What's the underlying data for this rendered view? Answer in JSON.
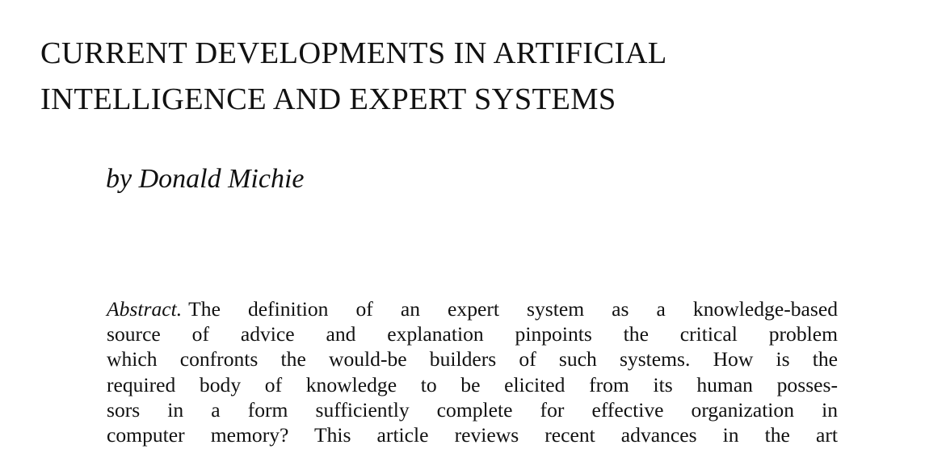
{
  "article": {
    "title_lines": [
      "CURRENT DEVELOPMENTS IN ARTIFICIAL",
      "INTELLIGENCE AND EXPERT SYSTEMS"
    ],
    "byline": "by Donald Michie",
    "abstract_label": "Abstract.",
    "abstract_lines": [
      "The definition of an expert system as a knowledge-based",
      "source of advice and explanation pinpoints the critical problem",
      "which confronts the would-be builders of such systems. How is the",
      "required body of knowledge to be elicited from its human posses-",
      "sors in a form sufficiently complete for effective organization in",
      "computer memory? This article reviews recent advances in the art"
    ]
  }
}
